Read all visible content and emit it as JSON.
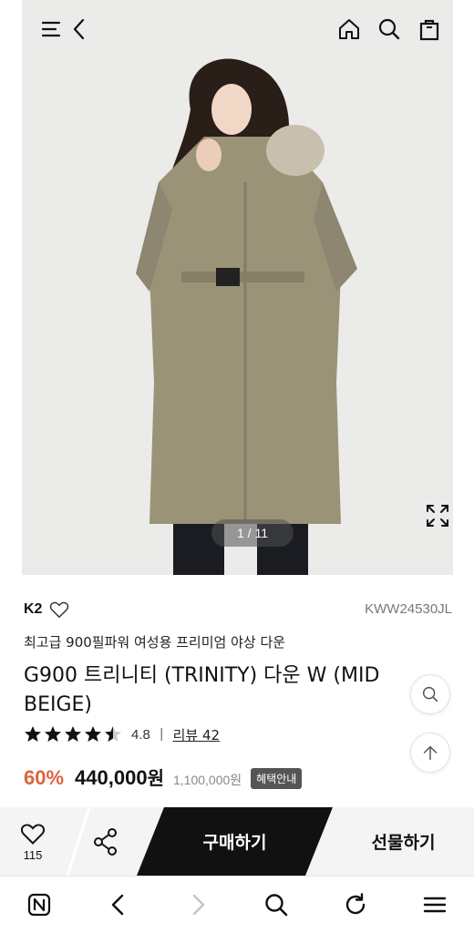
{
  "hero": {
    "pager": "1 / 11",
    "image_desc": "model wearing long beige hooded down coat with fur trim"
  },
  "topbar": {
    "icons": [
      "menu-icon",
      "back-icon",
      "home-icon",
      "search-icon",
      "cart-icon"
    ]
  },
  "product": {
    "brand": "K2",
    "code": "KWW24530JL",
    "subtitle": "최고급 900필파워 여성용 프리미엄 야상 다운",
    "title": "G900 트리니티 (TRINITY) 다운 W (MID BEIGE)",
    "rating": "4.8",
    "rating_value": 4.5,
    "rating_max": 5,
    "review_label": "리뷰 42",
    "discount": "60%",
    "price": "440,000",
    "currency": "원",
    "original_price": "1,100,000원",
    "benefit_label": "혜택안내"
  },
  "buybar": {
    "like_count": "115",
    "buy_label": "구매하기",
    "gift_label": "선물하기"
  },
  "colors": {
    "discount": "#e0623a",
    "buy_bg": "#111111",
    "coat": "#9a9377"
  }
}
